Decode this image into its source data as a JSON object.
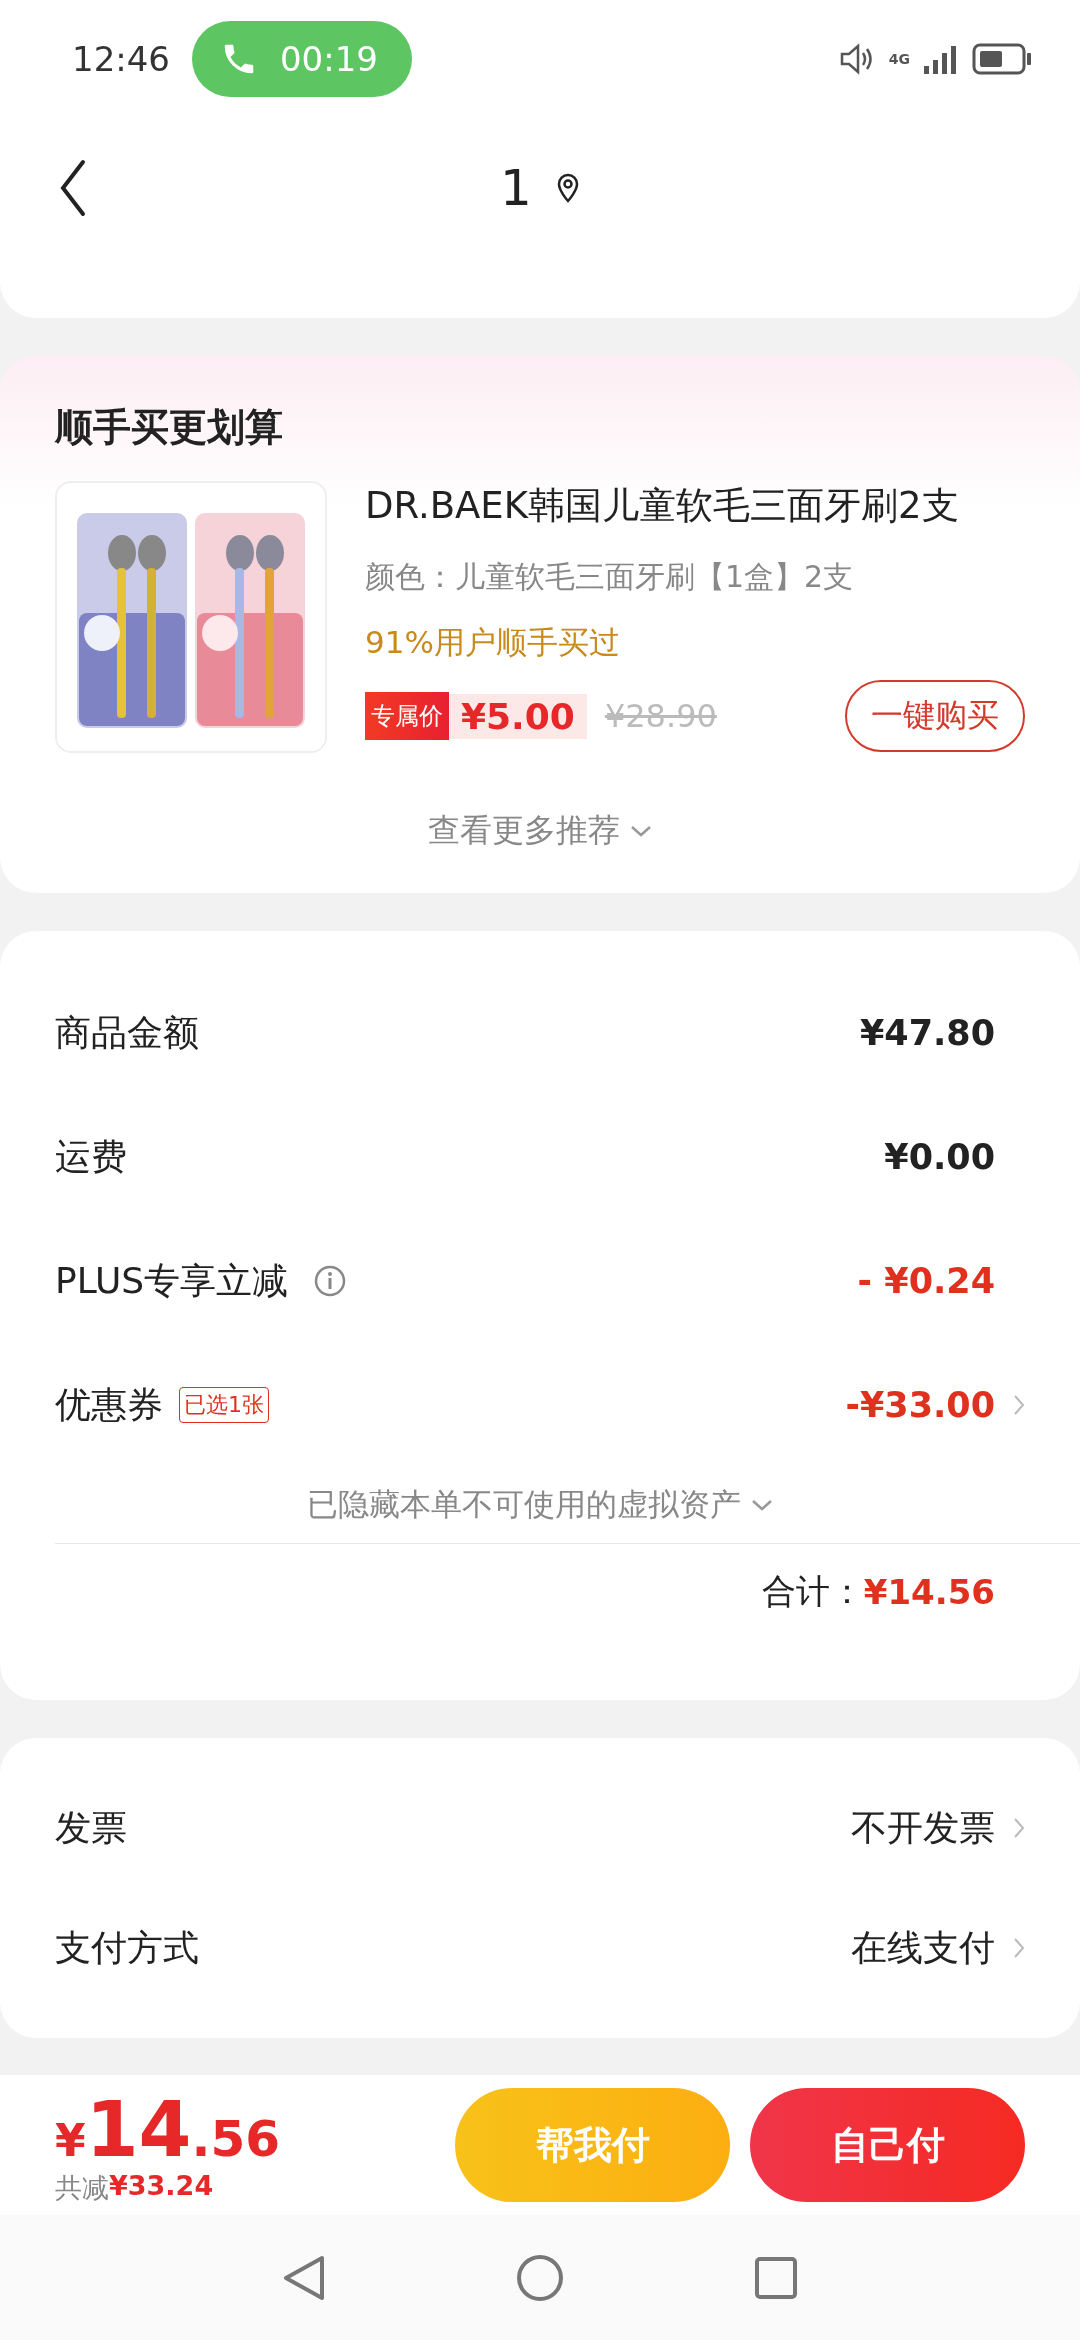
{
  "status_bar": {
    "time": "12:46",
    "call_timer": "00:19",
    "network": "4G"
  },
  "header": {
    "title": "1"
  },
  "recommend": {
    "title": "顺手买更划算",
    "product": {
      "kind": "picture",
      "name": "DR.BAEK韩国儿童软毛三面牙刷2支",
      "variant": "颜色：儿童软毛三面牙刷【1盒】2支",
      "social_proof": "91%用户顺手买过",
      "price_tag": "专属价",
      "price": "¥5.00",
      "original_price": "¥28.90",
      "buy_button": "一键购买"
    },
    "more": "查看更多推荐"
  },
  "summary": {
    "rows": [
      {
        "label": "商品金额",
        "value": "¥47.80",
        "kind": "amount",
        "info": false,
        "chevron": false
      },
      {
        "label": "运费",
        "value": "¥0.00",
        "kind": "amount",
        "info": false,
        "chevron": false
      },
      {
        "label": "PLUS专享立减",
        "value": "- ¥0.24",
        "kind": "discount",
        "info": true,
        "chevron": false
      },
      {
        "label": "优惠券",
        "tag": "已选1张",
        "value": "-¥33.00",
        "kind": "discount",
        "info": false,
        "chevron": true
      }
    ],
    "hidden_note": "已隐藏本单不可使用的虚拟资产",
    "total_label": "合计：",
    "total_value": "¥14.56"
  },
  "options": [
    {
      "label": "发票",
      "value": "不开发票"
    },
    {
      "label": "支付方式",
      "value": "在线支付"
    }
  ],
  "checkout": {
    "currency": "¥",
    "integer": "14",
    "decimal": ".56",
    "saved_label": "共减",
    "saved_value": "¥33.24",
    "buttons": [
      {
        "label": "帮我付",
        "kind": "secondary"
      },
      {
        "label": "自己付",
        "kind": "primary"
      }
    ]
  }
}
